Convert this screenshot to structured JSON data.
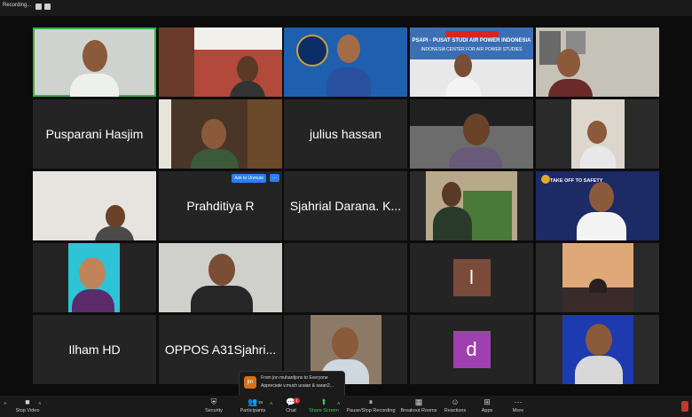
{
  "topbar": {
    "recording_label": "Recording..."
  },
  "tiles": [
    {
      "id": "t1",
      "kind": "video",
      "speaking": true
    },
    {
      "id": "t2",
      "kind": "video"
    },
    {
      "id": "t3",
      "kind": "video"
    },
    {
      "id": "t4",
      "kind": "video",
      "banner": "PSAPI - PUSAT STUDI AIR POWER INDONESIA",
      "banner2": "INDONESIA CENTER FOR AIR POWER STUDIES"
    },
    {
      "id": "t5",
      "kind": "video"
    },
    {
      "id": "t6",
      "kind": "name",
      "name": "Pusparani Hasjim"
    },
    {
      "id": "t7",
      "kind": "video"
    },
    {
      "id": "t8",
      "kind": "name",
      "name": "julius hassan"
    },
    {
      "id": "t9",
      "kind": "video"
    },
    {
      "id": "t10",
      "kind": "video"
    },
    {
      "id": "t11",
      "kind": "video"
    },
    {
      "id": "t12",
      "kind": "name",
      "name": "Prahditiya R",
      "ask_unmute": "Ask to Unmute",
      "more": "..."
    },
    {
      "id": "t13",
      "kind": "name",
      "name": "Sjahrial Darana. K..."
    },
    {
      "id": "t14",
      "kind": "video"
    },
    {
      "id": "t15",
      "kind": "video",
      "banner": "TAKE OFF TO SAFETY"
    },
    {
      "id": "t16",
      "kind": "video"
    },
    {
      "id": "t17",
      "kind": "video"
    },
    {
      "id": "t18",
      "kind": "empty"
    },
    {
      "id": "t19",
      "kind": "avatar",
      "letter": "l",
      "color": "#7a4a3a"
    },
    {
      "id": "t20",
      "kind": "video"
    },
    {
      "id": "t21",
      "kind": "name",
      "name": "Ilham HD"
    },
    {
      "id": "t22",
      "kind": "name",
      "name": "OPPOS A31Sjahri..."
    },
    {
      "id": "t23",
      "kind": "video"
    },
    {
      "id": "t24",
      "kind": "avatar",
      "letter": "d",
      "color": "#a040b0"
    },
    {
      "id": "t25",
      "kind": "video"
    }
  ],
  "chat_popup": {
    "avatar": "jm",
    "from": "From jon muhardjono to Everyone",
    "message": "Appreciate v.much uraian & saran2..."
  },
  "toolbar": {
    "stop_video": "Stop Video",
    "security": "Security",
    "participants": "Participants",
    "participants_count": "38",
    "chat": "Chat",
    "chat_badge": "1",
    "share_screen": "Share Screen",
    "pause_recording": "Pause/Stop Recording",
    "breakout": "Breakout Rooms",
    "reactions": "Reactions",
    "apps": "Apps",
    "more": "More"
  },
  "colors": {
    "speaking_border": "#3cb043",
    "share_green": "#3ec45a",
    "unmute_blue": "#2d7df6"
  }
}
